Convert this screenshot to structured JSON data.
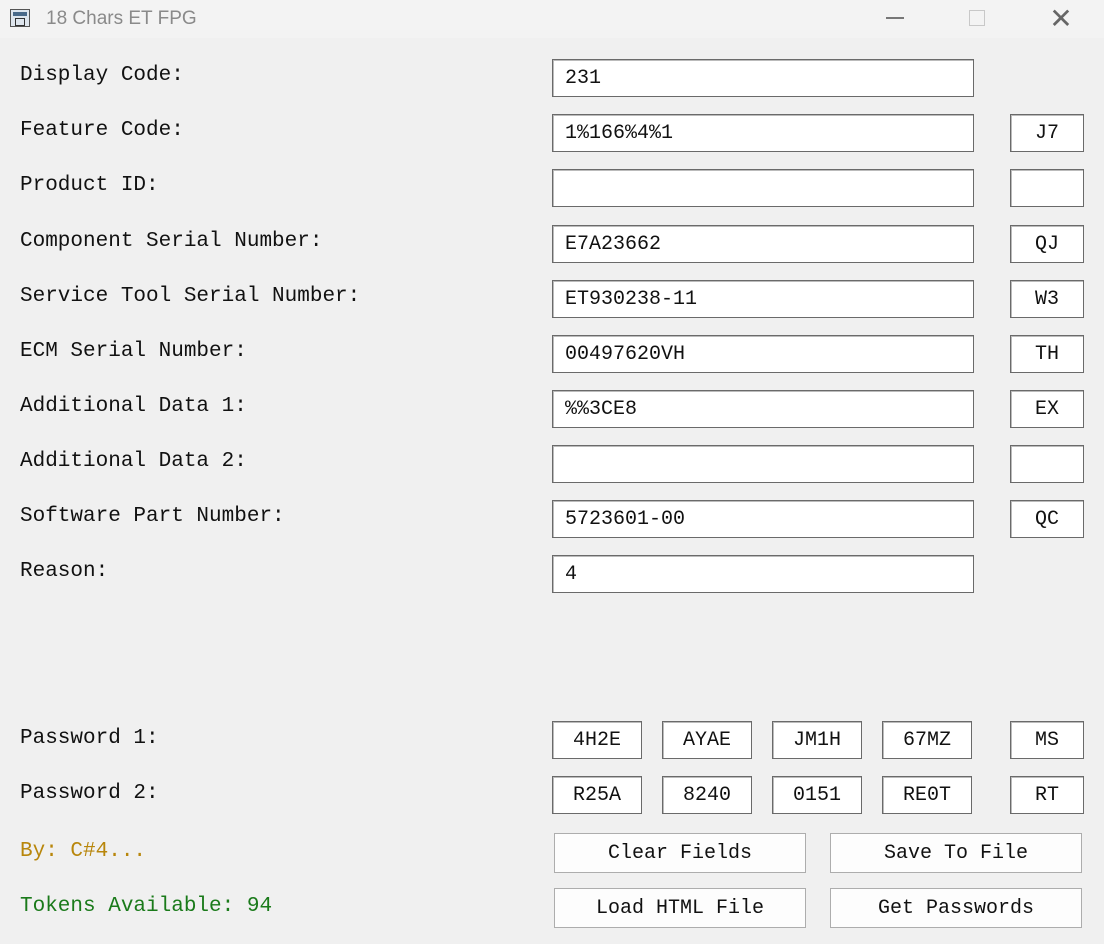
{
  "window": {
    "title": "18 Chars ET FPG",
    "close_glyph": "✕"
  },
  "fields": [
    {
      "label": "Display Code:",
      "value": "231",
      "check": null
    },
    {
      "label": "Feature Code:",
      "value": "1%166%4%1",
      "check": "J7"
    },
    {
      "label": "Product ID:",
      "value": "",
      "check": ""
    },
    {
      "label": "Component Serial Number:",
      "value": "E7A23662",
      "check": "QJ"
    },
    {
      "label": "Service Tool Serial Number:",
      "value": "ET930238-11",
      "check": "W3"
    },
    {
      "label": "ECM Serial Number:",
      "value": "00497620VH",
      "check": "TH"
    },
    {
      "label": "Additional Data 1:",
      "value": "%%3CE8",
      "check": "EX"
    },
    {
      "label": "Additional Data 2:",
      "value": "",
      "check": ""
    },
    {
      "label": "Software Part Number:",
      "value": "5723601-00",
      "check": "QC"
    },
    {
      "label": "Reason:",
      "value": "4",
      "check": null
    }
  ],
  "passwords": [
    {
      "label": "Password 1:",
      "parts": [
        "4H2E",
        "AYAE",
        "JM1H",
        "67MZ"
      ],
      "check": "MS"
    },
    {
      "label": "Password 2:",
      "parts": [
        "R25A",
        "8240",
        "0151",
        "RE0T"
      ],
      "check": "RT"
    }
  ],
  "credit": "By: C#4...",
  "tokens": "Tokens Available: 94",
  "buttons": {
    "clear": "Clear Fields",
    "save": "Save To File",
    "load": "Load HTML File",
    "get": "Get Passwords"
  },
  "colors": {
    "credit": "#b8860b",
    "tokens": "#1a7a1a",
    "background": "#f0f0f0"
  }
}
